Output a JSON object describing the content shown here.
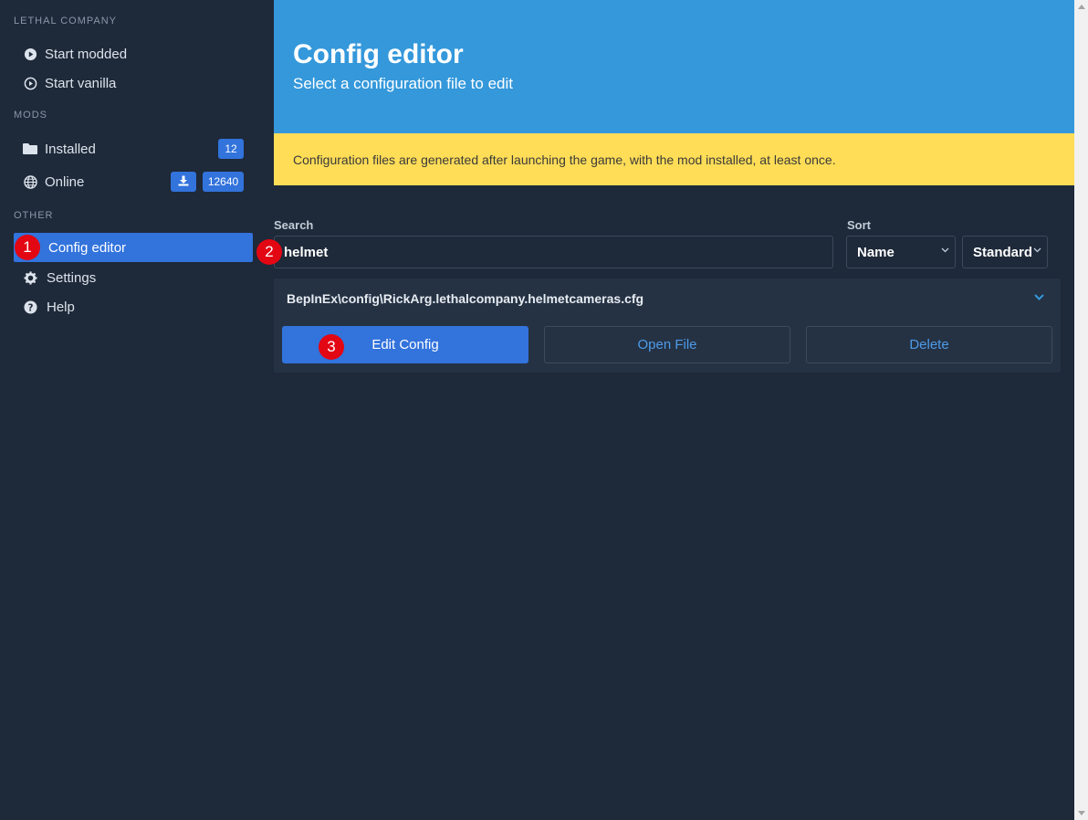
{
  "sidebar": {
    "sections": {
      "game": "LETHAL COMPANY",
      "mods": "MODS",
      "other": "OTHER"
    },
    "items": {
      "start_modded": "Start modded",
      "start_vanilla": "Start vanilla",
      "installed": "Installed",
      "installed_count": "12",
      "online": "Online",
      "online_count": "12640",
      "config_editor": "Config editor",
      "settings": "Settings",
      "help": "Help"
    }
  },
  "header": {
    "title": "Config editor",
    "subtitle": "Select a configuration file to edit"
  },
  "notice": "Configuration files are generated after launching the game, with the mod installed, at least once.",
  "search": {
    "label": "Search",
    "value": "helmet"
  },
  "sort": {
    "label": "Sort",
    "field": "Name",
    "order": "Standard"
  },
  "config_card": {
    "path": "BepInEx\\config\\RickArg.lethalcompany.helmetcameras.cfg",
    "edit_label": "Edit Config",
    "open_label": "Open File",
    "delete_label": "Delete"
  },
  "markers": {
    "one": "1",
    "two": "2",
    "three": "3"
  },
  "colors": {
    "background": "#1e2939",
    "accent": "#3273dc",
    "hero": "#3498db",
    "notice": "#ffdd57",
    "marker": "#e30613"
  }
}
